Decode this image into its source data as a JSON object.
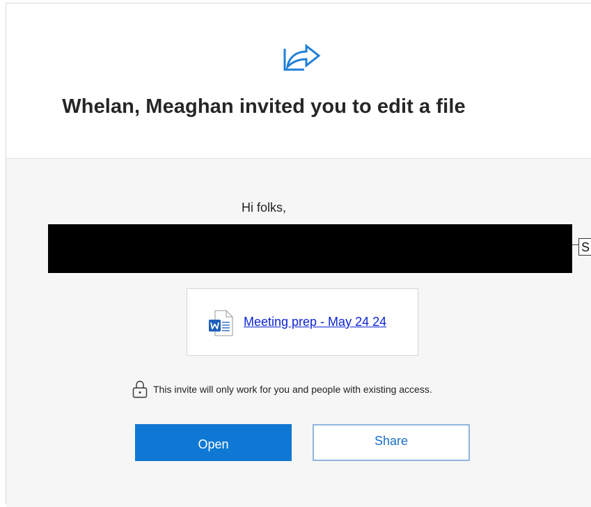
{
  "header": {
    "icon": "share-arrow-icon",
    "title": "Whelan, Meaghan invited you to edit a file"
  },
  "message": {
    "greeting": "Hi folks,",
    "truncated_char": "S"
  },
  "file": {
    "icon": "word-document-icon",
    "name": "Meeting prep - May 24 24"
  },
  "notice": {
    "icon": "lock-icon",
    "text": "This invite will only work for you and people with existing access."
  },
  "actions": {
    "open_label": "Open",
    "share_label": "Share"
  },
  "colors": {
    "primary": "#0f78d4",
    "link": "#0b24d6",
    "share_border": "#8fb6dd",
    "body_bg": "#f6f6f6"
  }
}
